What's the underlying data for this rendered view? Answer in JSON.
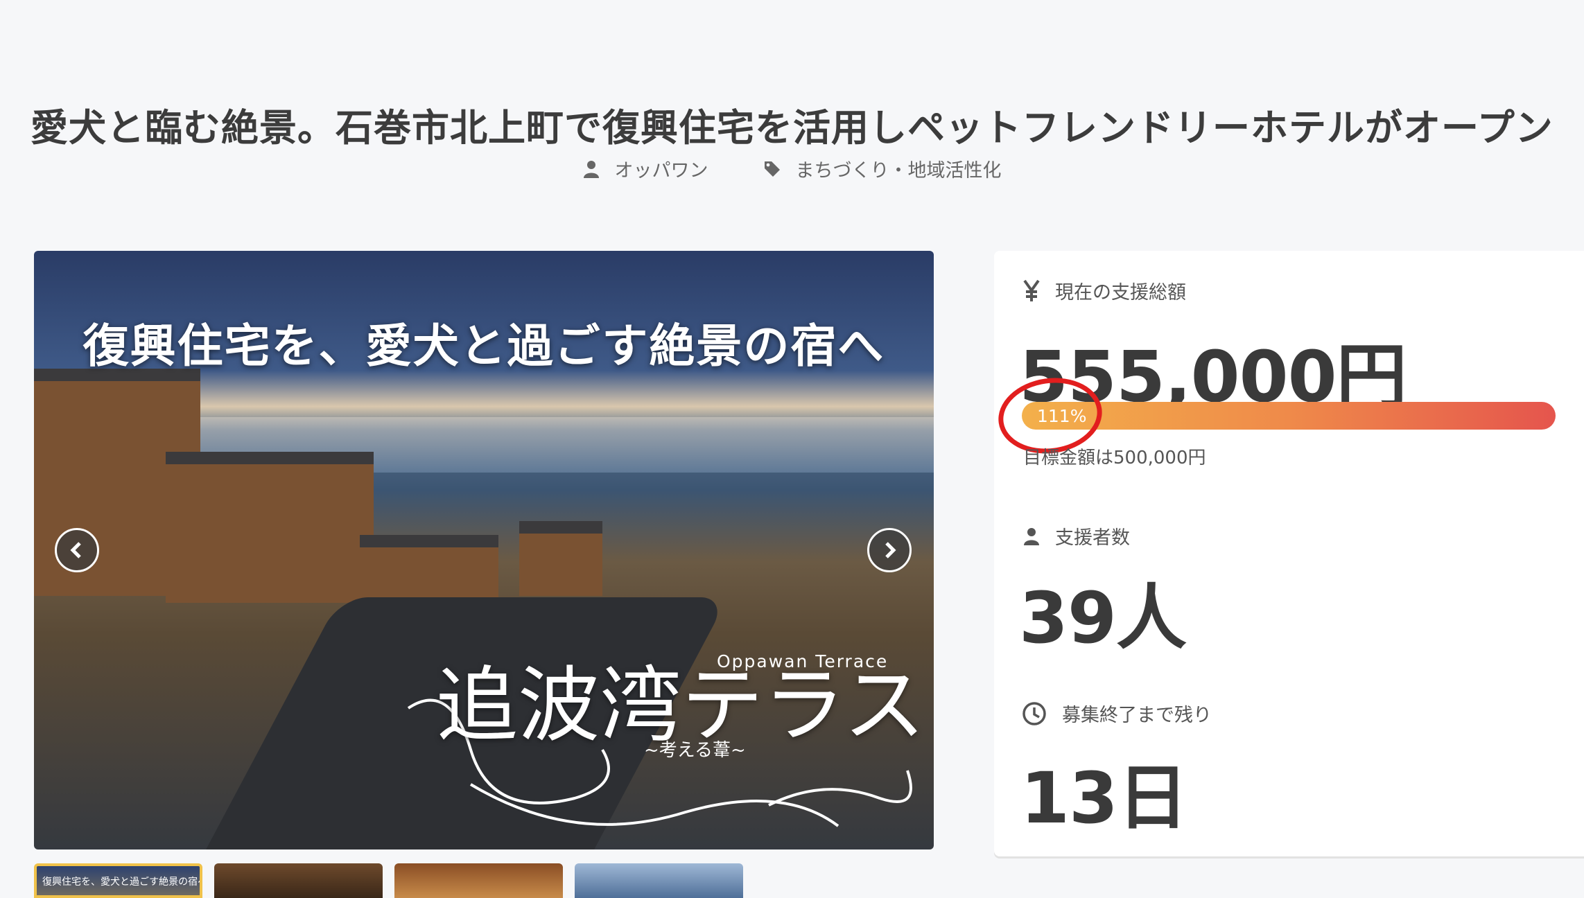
{
  "page": {
    "title": "愛犬と臨む絶景。石巻市北上町で復興住宅を活用しペットフレンドリーホテルがオープン",
    "author": "オッパワン",
    "category": "まちづくり・地域活性化"
  },
  "hero": {
    "headline": "復興住宅を、愛犬と過ごす絶景の宿へ",
    "logo_ja": "追波湾テラス",
    "logo_en": "Oppawan Terrace",
    "logo_sub": "~考える葦~"
  },
  "thumbnails": [
    {
      "caption": "復興住宅を、愛犬と過ごす絶景の宿へ"
    }
  ],
  "stats": {
    "total_label": "現在の支援総額",
    "total_value": "555,000円",
    "progress_percent": 111,
    "progress_text": "111%",
    "goal_text": "目標金額は500,000円",
    "supporters_label": "支援者数",
    "supporters_value": "39人",
    "remaining_label": "募集終了まで残り",
    "remaining_value": "13日"
  },
  "colors": {
    "progress_start": "#f3b04b",
    "progress_end": "#e5554d",
    "annotation": "#e21e1e"
  },
  "icons": [
    "user-icon",
    "tag-icon",
    "yen-icon",
    "clock-icon",
    "chevron-left-icon",
    "chevron-right-icon"
  ]
}
